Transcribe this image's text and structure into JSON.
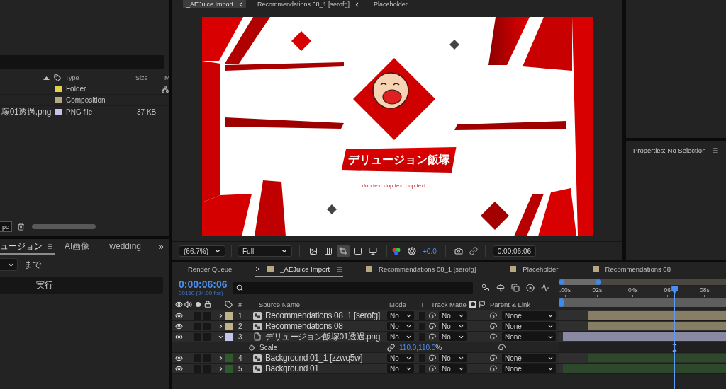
{
  "viewer_tabs": [
    {
      "label": "_AEJuice Import",
      "selected": true
    },
    {
      "label": "Recommendations 08_1 [serofg]",
      "selected": false
    },
    {
      "label": "Placeholder",
      "selected": false
    }
  ],
  "project": {
    "columns": [
      "Type",
      "Size",
      "M"
    ],
    "items": [
      {
        "kind": "folder",
        "type": "Folder",
        "color": "#e3cf4a"
      },
      {
        "kind": "composition",
        "type": "Composition",
        "color": "#b7a882"
      },
      {
        "kind": "file",
        "name": "塚01透過.png",
        "type": "PNG file",
        "size": "37 KB",
        "color": "#c4c4ec"
      }
    ],
    "bit_depth": "pc"
  },
  "script_panel": {
    "tabs": [
      {
        "label": "ュージョン",
        "selected": true
      },
      {
        "label": "AI画像",
        "selected": false
      },
      {
        "label": "wedding",
        "selected": false
      }
    ],
    "until_label": "まで",
    "run_button": "実行"
  },
  "viewer": {
    "composition": {
      "title": "デリュージョン飯塚",
      "subtitle": "dop text dop text dop text"
    },
    "zoom": "(66.7%)",
    "resolution": "Full",
    "view_toggles": [
      {
        "kind": "image",
        "on": false
      },
      {
        "kind": "grid",
        "on": false
      },
      {
        "kind": "crop",
        "on": true
      },
      {
        "kind": "square",
        "on": false
      },
      {
        "kind": "monitor",
        "on": false
      }
    ],
    "exposure": "+0.0",
    "timecode": "0:00:06:06"
  },
  "properties": {
    "title": "Properties: No Selection"
  },
  "timeline": {
    "tabs": [
      {
        "kind": "queue",
        "label": "Render Queue",
        "selected": false
      },
      {
        "kind": "comp",
        "label": "_AEJuice Import",
        "selected": true
      },
      {
        "kind": "comp",
        "label": "Recommendations 08_1 [serofg]",
        "selected": false
      },
      {
        "kind": "comp",
        "label": "Placeholder",
        "selected": false
      },
      {
        "kind": "comp",
        "label": "Recommendations 08",
        "selected": false
      }
    ],
    "current_time": "0:00:06:06",
    "frame_info": "00150 (24.00 fps)",
    "ruler": [
      ":00s",
      "02s",
      "04s",
      "06",
      "08s"
    ],
    "playhead": {
      "level": 0.69
    },
    "columns": {
      "number": "#",
      "source_name": "Source Name",
      "mode": "Mode",
      "track_matte_toggle": "T",
      "track_matte": "Track Matte",
      "parent": "Parent & Link"
    },
    "layers": [
      {
        "number": "1",
        "name": "Recommendations 08_1 [serofg]",
        "kind": "comp",
        "color": "#c2b28a",
        "expanded": false,
        "delayed": true,
        "mode": "No",
        "matte": "No",
        "parent": "None"
      },
      {
        "number": "2",
        "name": "Recommendations 08",
        "kind": "comp",
        "color": "#c2b28a",
        "expanded": false,
        "delayed": true,
        "mode": "No",
        "matte": "No",
        "parent": "None"
      },
      {
        "number": "3",
        "name": "デリュージョン飯塚01透過.png",
        "kind": "file",
        "color": "#c4c4ec",
        "expanded": true,
        "delayed": false,
        "mode": "No",
        "matte": "No",
        "parent": "None",
        "properties": [
          {
            "name": "Scale",
            "value": "110.0,110.0",
            "unit": "%"
          }
        ]
      },
      {
        "number": "4",
        "name": "Background 01_1 [zzwq5w]",
        "kind": "comp",
        "color": "#2f5a2c",
        "expanded": false,
        "delayed": true,
        "mode": "No",
        "matte": "No",
        "parent": "None"
      },
      {
        "number": "5",
        "name": "Background 01",
        "kind": "comp",
        "color": "#2f5a2c",
        "expanded": false,
        "delayed": false,
        "mode": "No",
        "matte": "No",
        "parent": "None"
      }
    ]
  }
}
